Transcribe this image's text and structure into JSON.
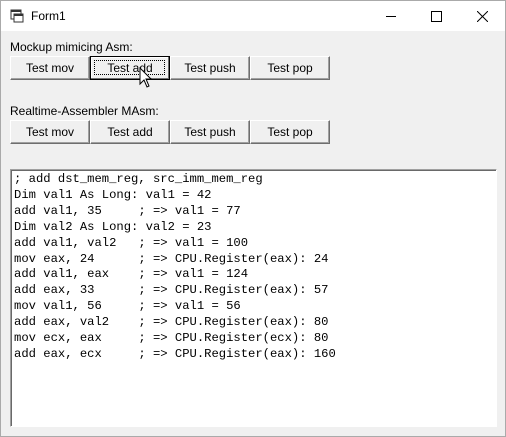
{
  "window": {
    "title": "Form1"
  },
  "mockup_group": {
    "label": "Mockup mimicing Asm:",
    "buttons": [
      "Test mov",
      "Test add",
      "Test push",
      "Test pop"
    ]
  },
  "masm_group": {
    "label": "Realtime-Assembler MAsm:",
    "buttons": [
      "Test mov",
      "Test add",
      "Test push",
      "Test pop"
    ]
  },
  "output": {
    "text": "; add dst_mem_reg, src_imm_mem_reg\nDim val1 As Long: val1 = 42\nadd val1, 35     ; => val1 = 77\nDim val2 As Long: val2 = 23\nadd val1, val2   ; => val1 = 100\nmov eax, 24      ; => CPU.Register(eax): 24\nadd val1, eax    ; => val1 = 124\nadd eax, 33      ; => CPU.Register(eax): 57\nmov val1, 56     ; => val1 = 56\nadd eax, val2    ; => CPU.Register(eax): 80\nmov ecx, eax     ; => CPU.Register(ecx): 80\nadd eax, ecx     ; => CPU.Register(eax): 160"
  }
}
